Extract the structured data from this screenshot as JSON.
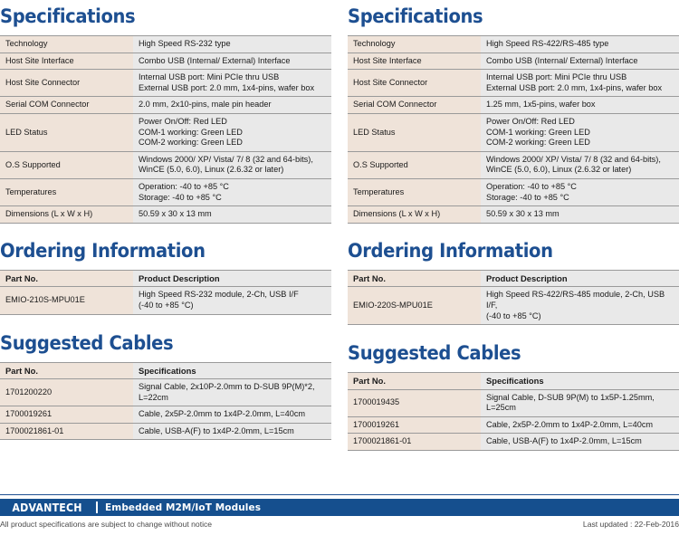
{
  "columns": [
    {
      "specs": {
        "heading": "Specifications",
        "rows": [
          {
            "label": "Technology",
            "value": "High Speed RS-232 type"
          },
          {
            "label": "Host Site Interface",
            "value": "Combo USB (Internal/ External) Interface"
          },
          {
            "label": "Host Site Connector",
            "value": "Internal USB port: Mini PCIe thru USB\nExternal USB port: 2.0 mm, 1x4-pins, wafer box"
          },
          {
            "label": "Serial COM Connector",
            "value": "2.0 mm, 2x10-pins, male pin header"
          },
          {
            "label": "LED Status",
            "value": "Power On/Off: Red LED\nCOM-1 working: Green LED\nCOM-2 working: Green LED"
          },
          {
            "label": "O.S Supported",
            "value": "Windows 2000/ XP/ Vista/ 7/ 8 (32 and 64-bits),\nWinCE (5.0, 6.0), Linux (2.6.32 or later)"
          },
          {
            "label": "Temperatures",
            "value": "Operation: -40 to +85 °C\nStorage: -40 to +85 °C"
          },
          {
            "label": "Dimensions (L x W x H)",
            "value": "50.59 x 30 x 13 mm"
          }
        ]
      },
      "ordering": {
        "heading": "Ordering Information",
        "headers": [
          "Part No.",
          "Product Description"
        ],
        "rows": [
          {
            "part_no": "EMIO-210S-MPU01E",
            "description": "High Speed RS-232 module, 2-Ch, USB I/F\n(-40 to +85 °C)"
          }
        ]
      },
      "cables": {
        "heading": "Suggested Cables",
        "headers": [
          "Part No.",
          "Specifications"
        ],
        "rows": [
          {
            "part_no": "1701200220",
            "description": "Signal Cable, 2x10P-2.0mm to D-SUB 9P(M)*2,\nL=22cm"
          },
          {
            "part_no": "1700019261",
            "description": "Cable, 2x5P-2.0mm to 1x4P-2.0mm, L=40cm"
          },
          {
            "part_no": "1700021861-01",
            "description": "Cable, USB-A(F) to 1x4P-2.0mm, L=15cm"
          }
        ]
      }
    },
    {
      "specs": {
        "heading": "Specifications",
        "rows": [
          {
            "label": "Technology",
            "value": "High Speed RS-422/RS-485 type"
          },
          {
            "label": "Host Site Interface",
            "value": "Combo USB (Internal/ External) Interface"
          },
          {
            "label": "Host Site Connector",
            "value": "Internal USB port: Mini PCIe thru USB\nExternal USB port: 2.0 mm, 1x4-pins, wafer box"
          },
          {
            "label": "Serial COM Connector",
            "value": "1.25 mm, 1x5-pins, wafer box"
          },
          {
            "label": "LED Status",
            "value": "Power On/Off: Red LED\nCOM-1 working: Green LED\nCOM-2 working: Green LED"
          },
          {
            "label": "O.S Supported",
            "value": "Windows 2000/ XP/ Vista/ 7/ 8 (32 and 64-bits),\nWinCE (5.0, 6.0), Linux (2.6.32 or later)"
          },
          {
            "label": "Temperatures",
            "value": "Operation: -40 to +85 °C\nStorage: -40 to +85 °C"
          },
          {
            "label": "Dimensions (L x W x H)",
            "value": "50.59 x 30 x 13 mm"
          }
        ]
      },
      "ordering": {
        "heading": "Ordering Information",
        "headers": [
          "Part No.",
          "Product Description"
        ],
        "rows": [
          {
            "part_no": "EMIO-220S-MPU01E",
            "description": "High Speed RS-422/RS-485 module, 2-Ch, USB I/F,\n(-40 to +85 °C)"
          }
        ]
      },
      "cables": {
        "heading": "Suggested Cables",
        "headers": [
          "Part No.",
          "Specifications"
        ],
        "rows": [
          {
            "part_no": "1700019435",
            "description": "Signal Cable, D-SUB 9P(M) to 1x5P-1.25mm,\nL=25cm"
          },
          {
            "part_no": "1700019261",
            "description": "Cable, 2x5P-2.0mm to 1x4P-2.0mm, L=40cm"
          },
          {
            "part_no": "1700021861-01",
            "description": "Cable, USB-A(F) to 1x4P-2.0mm, L=15cm"
          }
        ]
      }
    }
  ],
  "footer": {
    "logo": "ADVANTECH",
    "title": "Embedded M2M/IoT Modules",
    "disclaimer": "All product specifications are subject to change without notice",
    "last_updated": "Last updated : 22-Feb-2016"
  },
  "colors": {
    "heading_blue": "#1d4f91",
    "footer_blue": "#154f8e",
    "label_cell_bg": "#efe3d9",
    "value_cell_bg": "#e9e9e9",
    "rule": "#9a9a9a"
  }
}
